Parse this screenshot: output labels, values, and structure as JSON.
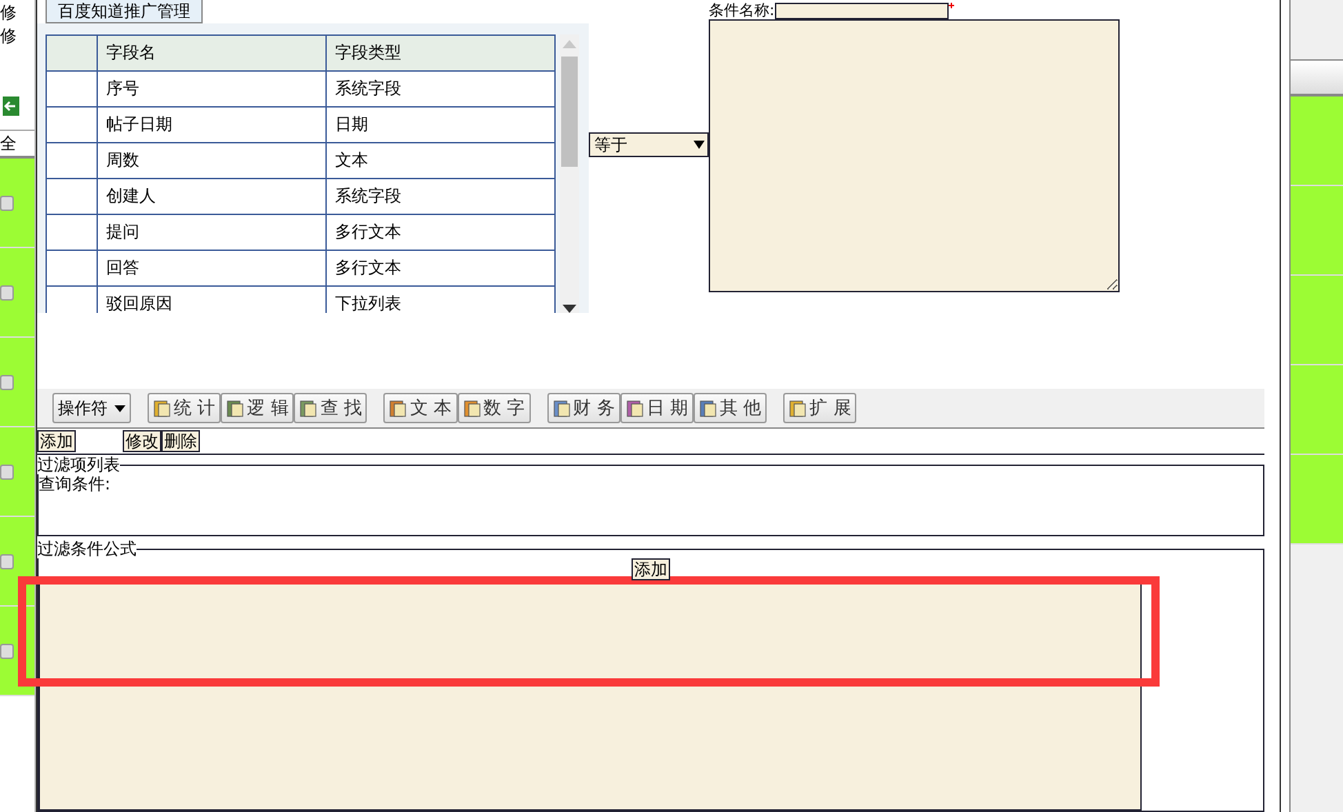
{
  "background": {
    "left_texts": [
      "修",
      "修"
    ],
    "left_header": "全"
  },
  "field_panel": {
    "tab": "百度知道推广管理",
    "columns": [
      "字段名",
      "字段类型"
    ],
    "rows": [
      {
        "name": "序号",
        "type": "系统字段"
      },
      {
        "name": "帖子日期",
        "type": "日期"
      },
      {
        "name": "周数",
        "type": "文本"
      },
      {
        "name": "创建人",
        "type": "系统字段"
      },
      {
        "name": "提问",
        "type": "多行文本"
      },
      {
        "name": "回答",
        "type": "多行文本"
      },
      {
        "name": "驳回原因",
        "type": "下拉列表"
      }
    ]
  },
  "operator": {
    "value": "等于"
  },
  "condition": {
    "label": "条件名称:"
  },
  "toolbar": [
    [
      {
        "label": "操作符",
        "kind": "dropdown"
      }
    ],
    [
      {
        "label": "统 计",
        "kind": "button"
      },
      {
        "label": "逻 辑",
        "kind": "button"
      },
      {
        "label": "查 找",
        "kind": "button"
      }
    ],
    [
      {
        "label": "文 本",
        "kind": "button"
      },
      {
        "label": "数 字",
        "kind": "button"
      }
    ],
    [
      {
        "label": "财 务",
        "kind": "button"
      },
      {
        "label": "日 期",
        "kind": "button"
      },
      {
        "label": "其 他",
        "kind": "button"
      }
    ],
    [
      {
        "label": "扩 展",
        "kind": "button"
      }
    ]
  ],
  "actions": [
    "添加",
    "修改",
    "删除"
  ],
  "filter_list": {
    "legend": "过滤项列表",
    "label": "查询条件:"
  },
  "formula": {
    "legend": "过滤条件公式",
    "add_button": "添加"
  }
}
